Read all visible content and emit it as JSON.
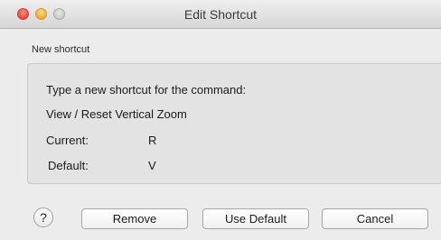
{
  "window": {
    "title": "Edit Shortcut"
  },
  "group": {
    "label": "New shortcut",
    "instruction": "Type a new shortcut for the command:",
    "command": "View / Reset Vertical Zoom",
    "current_label": "Current:",
    "current_value": "R",
    "default_label": "Default:",
    "default_value": "V"
  },
  "buttons": {
    "help": "?",
    "remove": "Remove",
    "use_default": "Use Default",
    "cancel": "Cancel"
  },
  "icons": {
    "close": "close-icon",
    "minimize": "minimize-icon",
    "zoom": "zoom-icon"
  }
}
